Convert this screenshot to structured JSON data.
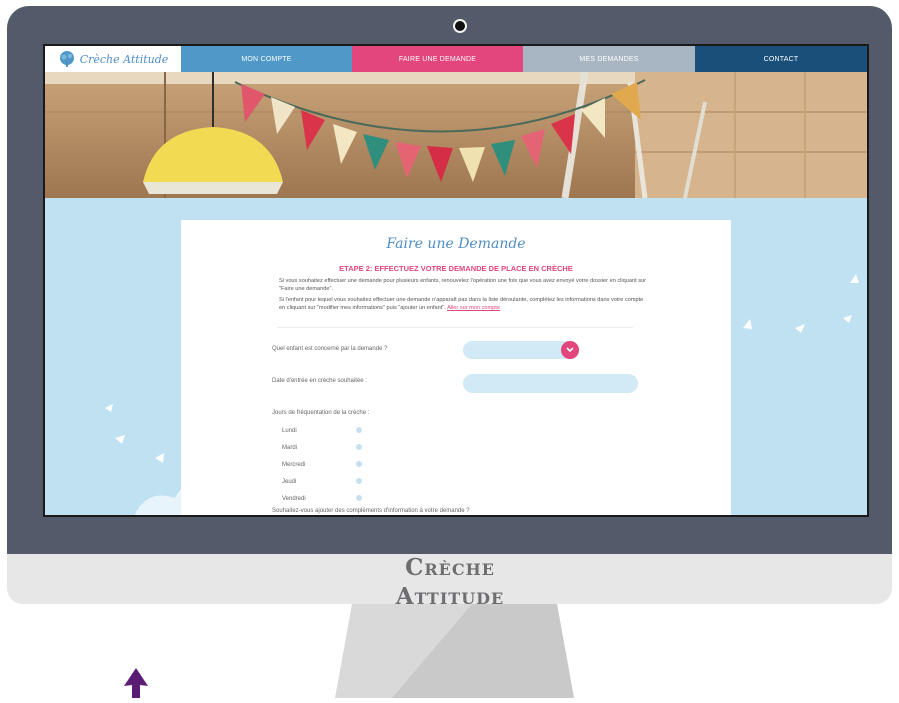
{
  "nav": {
    "logo_text": "Crèche Attitude",
    "tabs": [
      {
        "label": "MON COMPTE"
      },
      {
        "label": "FAIRE UNE DEMANDE"
      },
      {
        "label": "MES DEMANDES"
      },
      {
        "label": "CONTACT"
      }
    ]
  },
  "page": {
    "title": "Faire une Demande",
    "step_title": "ETAPE 2: EFFECTUEZ VOTRE DEMANDE DE PLACE EN CRÈCHE",
    "paragraph1": "Si vous souhaitez effectuer une demande pour plusieurs enfants, renouvelez l'opération une fois que vous avez envoyé votre dossier en cliquant sur \"Faire une demande\".",
    "paragraph2": "Si l'enfant pour lequel vous souhaitez effectuer une demande n'apparaît pas dans la liste déroulante, complétez les informations dans votre compte en cliquant sur \"modifier mes informations\" puis \"ajouter un enfant\". ",
    "paragraph2_link": "Aller sur mon compte"
  },
  "form": {
    "child_question": "Quel enfant est concerné par la demande ?",
    "date_question": "Date d'entrée en crèche souhaitée :",
    "days_question": "Jours de fréquentation de la crèche :",
    "days": [
      "Lundi",
      "Mardi",
      "Mercredi",
      "Jeudi",
      "Vendredi"
    ],
    "extra_question": "Souhaitez-vous ajouter des compléments d'information à votre demande ?"
  },
  "brand": {
    "line1": "Crèche",
    "line2": "Attitude"
  },
  "colors": {
    "bezel": "#535a69",
    "accent_pink": "#e2467c",
    "accent_blue": "#4f98c7",
    "navy": "#194f78",
    "sky": "#bfe1f1"
  }
}
